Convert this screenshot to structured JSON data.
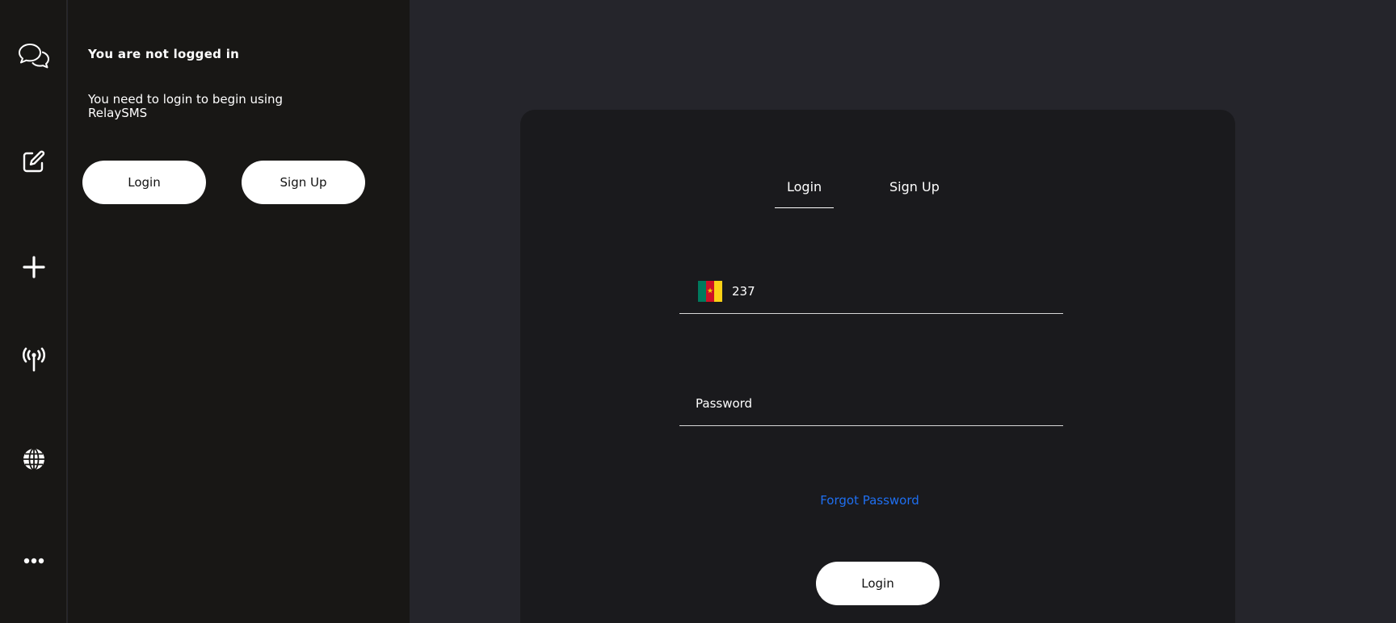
{
  "rail": {
    "items": [
      {
        "icon": "chat-icon",
        "name": "messages"
      },
      {
        "icon": "compose-icon",
        "name": "compose"
      },
      {
        "icon": "plus-icon",
        "name": "add"
      },
      {
        "icon": "antenna-icon",
        "name": "gateway"
      },
      {
        "icon": "globe-icon",
        "name": "language"
      },
      {
        "icon": "more-icon",
        "name": "more"
      }
    ]
  },
  "sidebar": {
    "title": "You are not logged in",
    "message": "You need to login to begin using RelaySMS",
    "login_label": "Login",
    "signup_label": "Sign Up"
  },
  "auth": {
    "tabs": [
      {
        "label": "Login",
        "active": true
      },
      {
        "label": "Sign Up",
        "active": false
      }
    ],
    "phone": {
      "country_code": "237",
      "flag_colors": [
        "#007a5e",
        "#ce1126",
        "#fcd116"
      ]
    },
    "password": {
      "placeholder": "Password"
    },
    "forgot_label": "Forgot Password",
    "submit_label": "Login"
  },
  "colors": {
    "background": "#25252b",
    "sidebar": "#181715",
    "card": "#1a1a1d",
    "link": "#1f6ff0",
    "button": "#ffffff"
  }
}
